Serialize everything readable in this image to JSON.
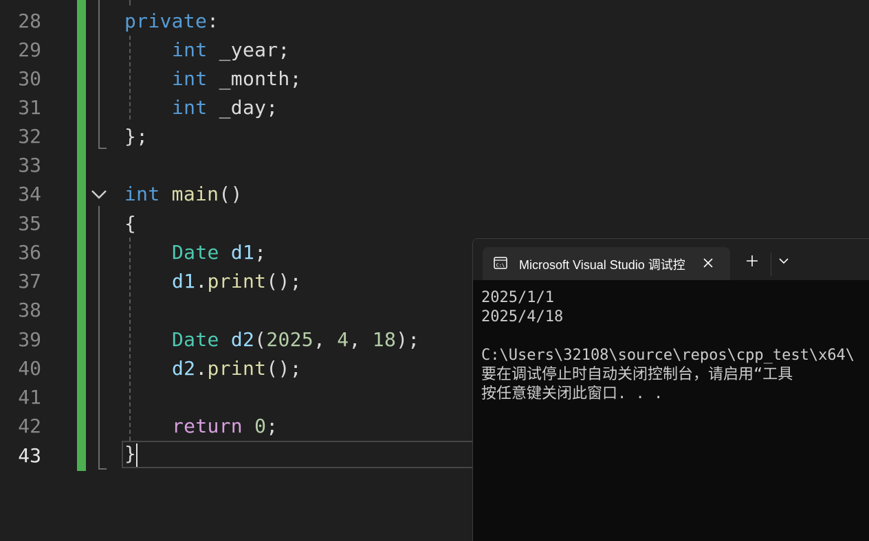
{
  "editor": {
    "line_numbers": [
      "28",
      "29",
      "30",
      "31",
      "32",
      "33",
      "34",
      "35",
      "36",
      "37",
      "38",
      "39",
      "40",
      "41",
      "42",
      "43"
    ],
    "current_line": "43",
    "colors": {
      "change_bar": "#4cb050",
      "keyword": "#569cd6",
      "type": "#4ec9b0",
      "function": "#dcdcaa",
      "variable": "#9cdcfe",
      "number": "#b5cea8",
      "control_keyword": "#d8a0df"
    },
    "code": {
      "l28_private": "private",
      "l28_colon": ":",
      "l29_kw": "int",
      "l29_rest": " _year;",
      "l30_kw": "int",
      "l30_rest": " _month;",
      "l31_kw": "int",
      "l31_rest": " _day;",
      "l32": "};",
      "l34_kw": "int",
      "l34_fn": "main",
      "l34_rest": "()",
      "l35": "{",
      "l36_type": "Date",
      "l36_var": "d1",
      "l36_rest": ";",
      "l37_var": "d1",
      "l37_dot": ".",
      "l37_fn": "print",
      "l37_rest": "();",
      "l39_type": "Date",
      "l39_var": "d2",
      "l39_open": "(",
      "l39_n1": "2025",
      "l39_c1": ", ",
      "l39_n2": "4",
      "l39_c2": ", ",
      "l39_n3": "18",
      "l39_close": ");",
      "l40_var": "d2",
      "l40_dot": ".",
      "l40_fn": "print",
      "l40_rest": "();",
      "l42_kw": "return",
      "l42_num": "0",
      "l42_rest": ";",
      "l43": "}"
    }
  },
  "terminal": {
    "tab_title": "Microsoft Visual Studio 调试控",
    "tab_icon": "console-icon",
    "output_lines": [
      "2025/1/1",
      "2025/4/18",
      "",
      "C:\\Users\\32108\\source\\repos\\cpp_test\\x64\\",
      "要在调试停止时自动关闭控制台，请启用“工具",
      "按任意键关闭此窗口. . ."
    ]
  }
}
